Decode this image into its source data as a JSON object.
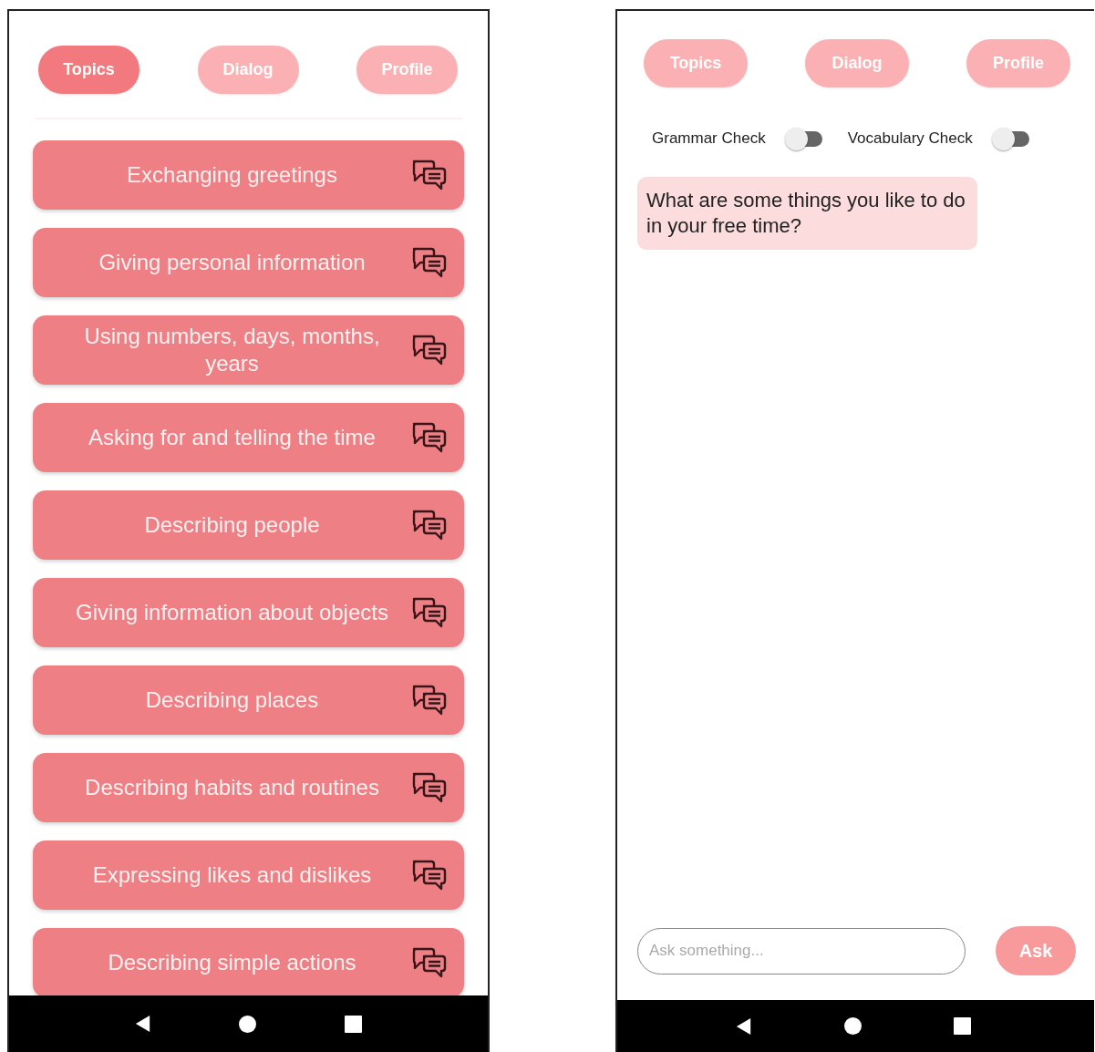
{
  "topics_screen": {
    "tabs": [
      {
        "label": "Topics",
        "selected": true
      },
      {
        "label": "Dialog",
        "selected": false
      },
      {
        "label": "Profile",
        "selected": false
      }
    ],
    "topics": [
      "Exchanging greetings",
      "Giving personal information",
      "Using numbers, days, months, years",
      "Asking for and telling the time",
      "Describing people",
      "Giving information about objects",
      "Describing places",
      "Describing habits and routines",
      "Expressing likes and dislikes",
      "Describing simple actions"
    ]
  },
  "dialog_screen": {
    "tabs": [
      {
        "label": "Topics",
        "selected": false
      },
      {
        "label": "Dialog",
        "selected": false
      },
      {
        "label": "Profile",
        "selected": false
      }
    ],
    "toggles": [
      {
        "label": "Grammar Check",
        "on": false
      },
      {
        "label": "Vocabulary Check",
        "on": false
      }
    ],
    "message": "What are some things you like to do in your free time?",
    "input": {
      "placeholder": "Ask something..."
    },
    "ask_button": "Ask"
  }
}
